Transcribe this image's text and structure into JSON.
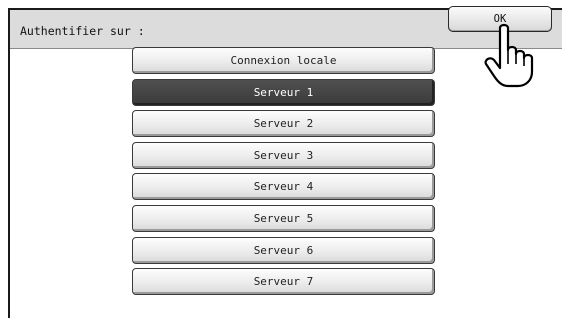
{
  "header": {
    "title": "Authentifier sur :",
    "ok_label": "OK"
  },
  "options": {
    "selected_index": 1,
    "items": [
      {
        "label": "Connexion locale"
      },
      {
        "label": "Serveur 1"
      },
      {
        "label": "Serveur 2"
      },
      {
        "label": "Serveur 3"
      },
      {
        "label": "Serveur 4"
      },
      {
        "label": "Serveur 5"
      },
      {
        "label": "Serveur 6"
      },
      {
        "label": "Serveur 7"
      }
    ]
  },
  "icons": {
    "pointer": "pointing-hand-icon"
  },
  "colors": {
    "titlebar": "#dcdcdc",
    "selected_item": "#444444",
    "button_face": "#eeeeee"
  }
}
